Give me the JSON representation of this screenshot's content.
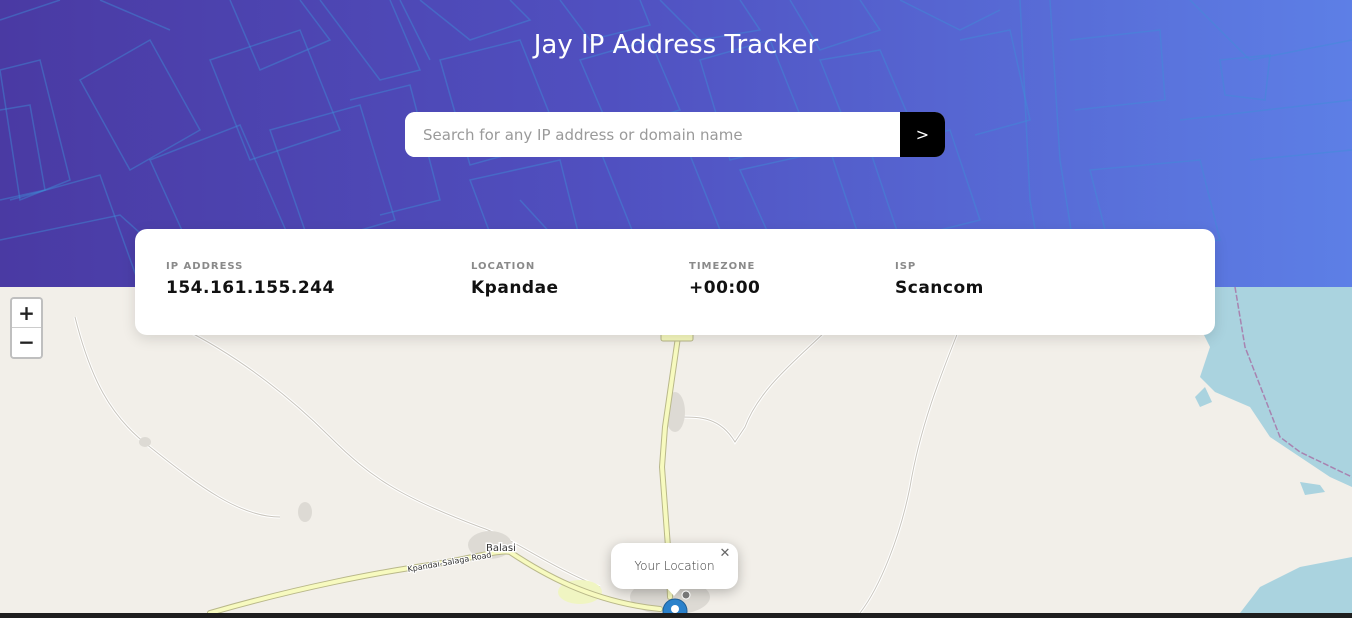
{
  "header": {
    "title": "Jay IP Address Tracker",
    "gradient_colors": [
      "#4a3aa3",
      "#5d7fe6"
    ]
  },
  "search": {
    "placeholder": "Search for any IP address or domain name",
    "value": "",
    "submit_label": ">"
  },
  "info": {
    "ip_label": "IP ADDRESS",
    "ip_value": "154.161.155.244",
    "location_label": "LOCATION",
    "location_value": "Kpandae",
    "timezone_label": "TIMEZONE",
    "timezone_value": "+00:00",
    "isp_label": "ISP",
    "isp_value": "Scancom"
  },
  "map": {
    "zoom_in_label": "+",
    "zoom_out_label": "−",
    "place_labels": [
      "Balasi",
      "Kpandai-Salaga Road"
    ],
    "popup_text": "Your Location",
    "popup_close": "✕",
    "marker_icon": "location-marker-icon",
    "water_color": "#aad3df",
    "land_color": "#f2efe9",
    "road_color": "#f7fabf"
  }
}
